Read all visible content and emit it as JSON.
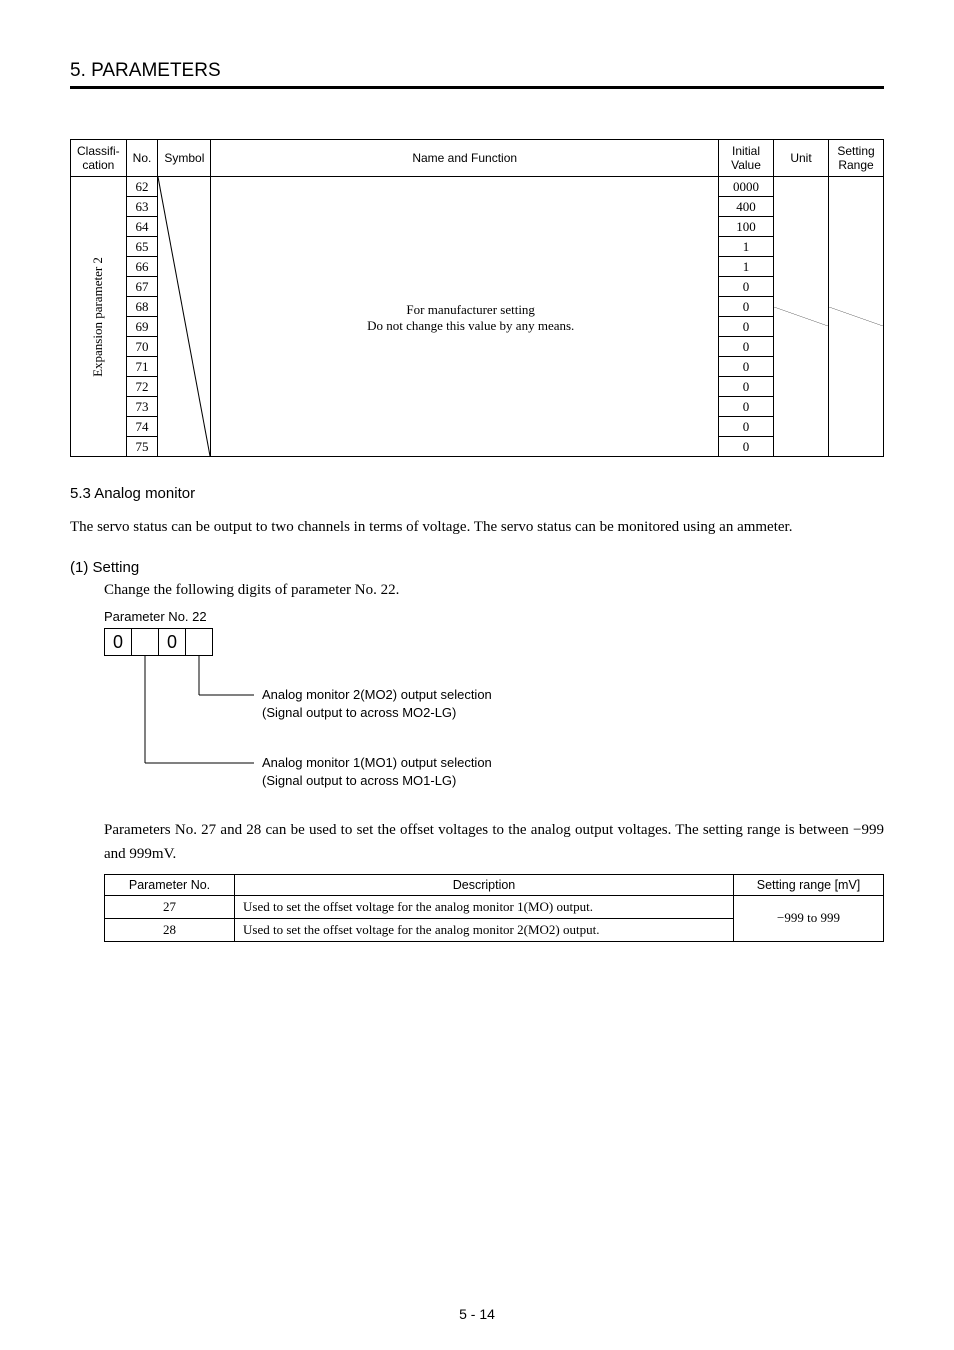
{
  "section": "5. PARAMETERS",
  "table1": {
    "headers": {
      "classification": "Classifi-\ncation",
      "no": "No.",
      "symbol": "Symbol",
      "name": "Name and Function",
      "initial": "Initial\nValue",
      "unit": "Unit",
      "range": "Setting\nRange"
    },
    "classification_label": "Expansion parameter 2",
    "name_line1": "For manufacturer setting",
    "name_line2": "Do not change this value by any means.",
    "rows": [
      {
        "no": "62",
        "value": "0000"
      },
      {
        "no": "63",
        "value": "400"
      },
      {
        "no": "64",
        "value": "100"
      },
      {
        "no": "65",
        "value": "1"
      },
      {
        "no": "66",
        "value": "1"
      },
      {
        "no": "67",
        "value": "0"
      },
      {
        "no": "68",
        "value": "0"
      },
      {
        "no": "69",
        "value": "0"
      },
      {
        "no": "70",
        "value": "0"
      },
      {
        "no": "71",
        "value": "0"
      },
      {
        "no": "72",
        "value": "0"
      },
      {
        "no": "73",
        "value": "0"
      },
      {
        "no": "74",
        "value": "0"
      },
      {
        "no": "75",
        "value": "0"
      }
    ]
  },
  "analog_monitor": {
    "heading": "5.3 Analog monitor",
    "body": "The servo status can be output to two channels in terms of voltage. The servo status can be monitored using an ammeter."
  },
  "setting": {
    "heading": "(1) Setting",
    "line": "Change the following digits of parameter No. 22.",
    "param_title": "Parameter No. 22",
    "boxes": [
      "0",
      "",
      "0",
      ""
    ],
    "label1a": "Analog monitor 2(MO2) output selection",
    "label1b": "(Signal output to across MO2-LG)",
    "label2a": "Analog monitor 1(MO1) output selection",
    "label2b": "(Signal output to across MO1-LG)"
  },
  "offset": {
    "body": "Parameters No. 27 and 28 can be used to set the offset voltages to the analog output voltages. The setting range is between −999 and 999mV."
  },
  "table2": {
    "headers": {
      "pno": "Parameter No.",
      "desc": "Description",
      "range": "Setting range [mV]"
    },
    "rows": [
      {
        "pno": "27",
        "desc": "Used to set the offset voltage for the analog monitor 1(MO) output."
      },
      {
        "pno": "28",
        "desc": "Used to set the offset voltage for the analog monitor 2(MO2) output."
      }
    ],
    "range": "−999 to 999"
  },
  "page_num": "5 -  14"
}
